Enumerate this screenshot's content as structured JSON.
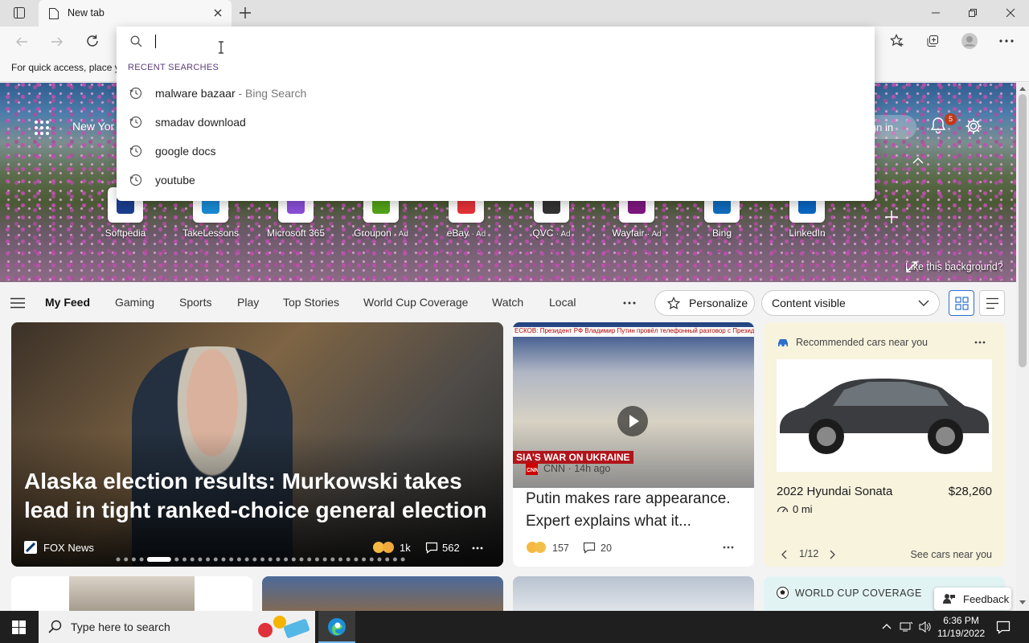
{
  "browser": {
    "tab_title": "New tab",
    "favorites_hint": "For quick access, place y",
    "address_placeholder": ""
  },
  "suggestions": {
    "section_label": "RECENT SEARCHES",
    "items": [
      {
        "text": "malware bazaar",
        "suffix": " - Bing Search"
      },
      {
        "text": "smadav download",
        "suffix": ""
      },
      {
        "text": "google docs",
        "suffix": ""
      },
      {
        "text": "youtube",
        "suffix": ""
      }
    ]
  },
  "newtab": {
    "location": "New Yor",
    "signin": "ign in",
    "notification_count": "5",
    "like_background": "Like this background?",
    "quick_links": [
      {
        "label": "Softpedia",
        "ad": "",
        "icon": "softpedia-icon",
        "color": "#1b3f8f"
      },
      {
        "label": "TakeLessons",
        "ad": "",
        "icon": "takelessons-icon",
        "color": "#1a8ad4"
      },
      {
        "label": "Microsoft 365",
        "ad": "",
        "icon": "microsoft365-icon",
        "color": "#8a4fd8"
      },
      {
        "label": "Groupon",
        "ad": "· Ad",
        "icon": "groupon-icon",
        "color": "#53a318"
      },
      {
        "label": "eBay",
        "ad": "· Ad",
        "icon": "ebay-icon",
        "color": "#e53238"
      },
      {
        "label": "QVC",
        "ad": "· Ad",
        "icon": "qvc-icon",
        "color": "#333333"
      },
      {
        "label": "Wayfair",
        "ad": "· Ad",
        "icon": "wayfair-icon",
        "color": "#7f187f"
      },
      {
        "label": "Bing",
        "ad": "",
        "icon": "bing-icon",
        "color": "#0f6cbd"
      },
      {
        "label": "LinkedIn",
        "ad": "",
        "icon": "linkedin-icon",
        "color": "#0a66c2"
      }
    ]
  },
  "feed": {
    "tabs": [
      "My Feed",
      "Gaming",
      "Sports",
      "Play",
      "Top Stories",
      "World Cup Coverage",
      "Watch",
      "Local"
    ],
    "personalize": "Personalize",
    "content_visible": "Content visible"
  },
  "cards": {
    "main": {
      "headline": "Alaska election results: Murkowski takes lead in tight ranked-choice general election",
      "source": "FOX News",
      "reactions": "1k",
      "comments": "562"
    },
    "video": {
      "ticker": "ЕСКОВ: Президент РФ Владимир Путин провёл телефонный разговор с Президент",
      "ticker_tag": "Ru",
      "banner": "SIA'S WAR ON UKRAINE",
      "source": "CNN · 14h ago",
      "title": "Putin makes rare appearance. Expert explains what it...",
      "reactions": "157",
      "comments": "20"
    },
    "cars": {
      "header": "Recommended cars near you",
      "model": "2022 Hyundai Sonata",
      "price": "$28,260",
      "distance": "0 mi",
      "page": "1/12",
      "see_more": "See cars near you"
    },
    "worldcup": {
      "header": "WORLD CUP COVERAGE"
    }
  },
  "feedback": "Feedback",
  "taskbar": {
    "search_placeholder": "Type here to search",
    "time": "6:36 PM",
    "date": "11/19/2022"
  }
}
